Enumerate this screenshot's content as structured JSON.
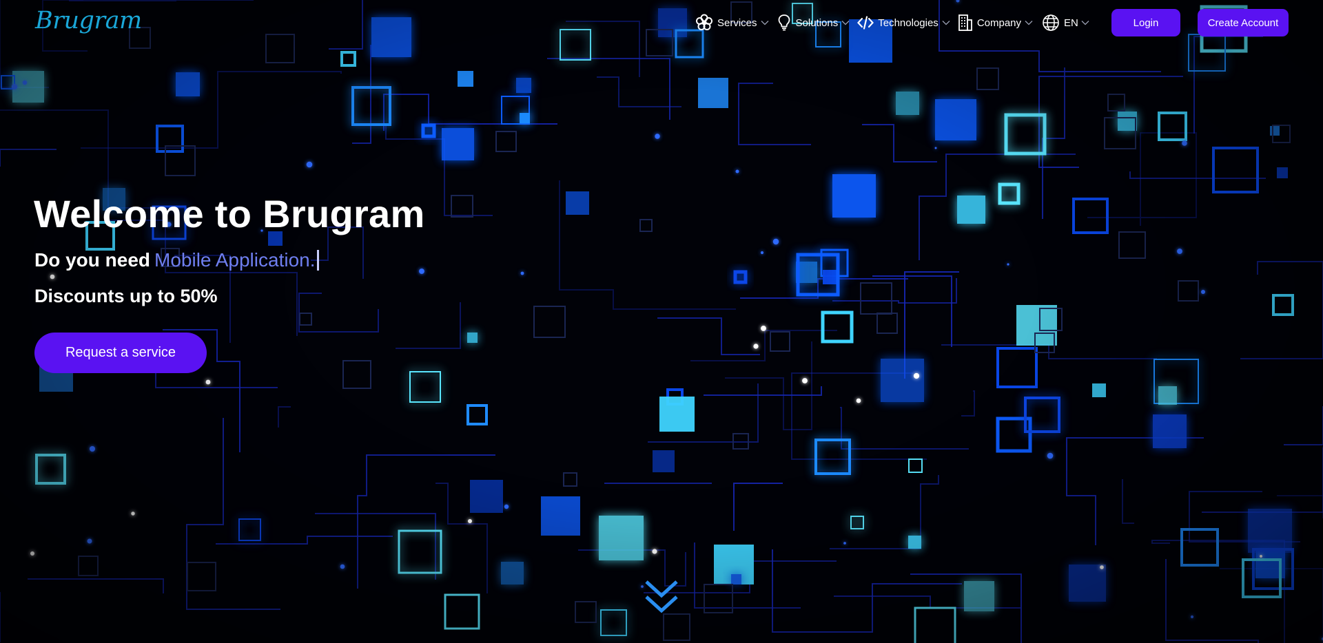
{
  "brand": {
    "logo_text": "Brugram"
  },
  "nav": {
    "items": [
      {
        "label": "Services",
        "icon": "flower-icon"
      },
      {
        "label": "Solutions",
        "icon": "lightbulb-icon"
      },
      {
        "label": "Technologies",
        "icon": "code-icon"
      },
      {
        "label": "Company",
        "icon": "building-icon"
      }
    ],
    "language": {
      "label": "EN",
      "icon": "globe-icon"
    }
  },
  "auth": {
    "login_label": "Login",
    "create_account_label": "Create Account"
  },
  "hero": {
    "title": "Welcome to Brugram",
    "question_prefix": "Do you need",
    "typed_text": "Mobile Application.",
    "discount_text": "Discounts up to 50%",
    "cta_label": "Request a service"
  },
  "scroll_icon": "double-chevron-down-icon",
  "colors": {
    "accent": "#5a12f2",
    "logo": "#1aa7d8",
    "typed_text": "#6f7ff0",
    "background": "#010208",
    "circuit_blue": "#1b2fd6",
    "glow_cyan": "#33d6ff"
  }
}
